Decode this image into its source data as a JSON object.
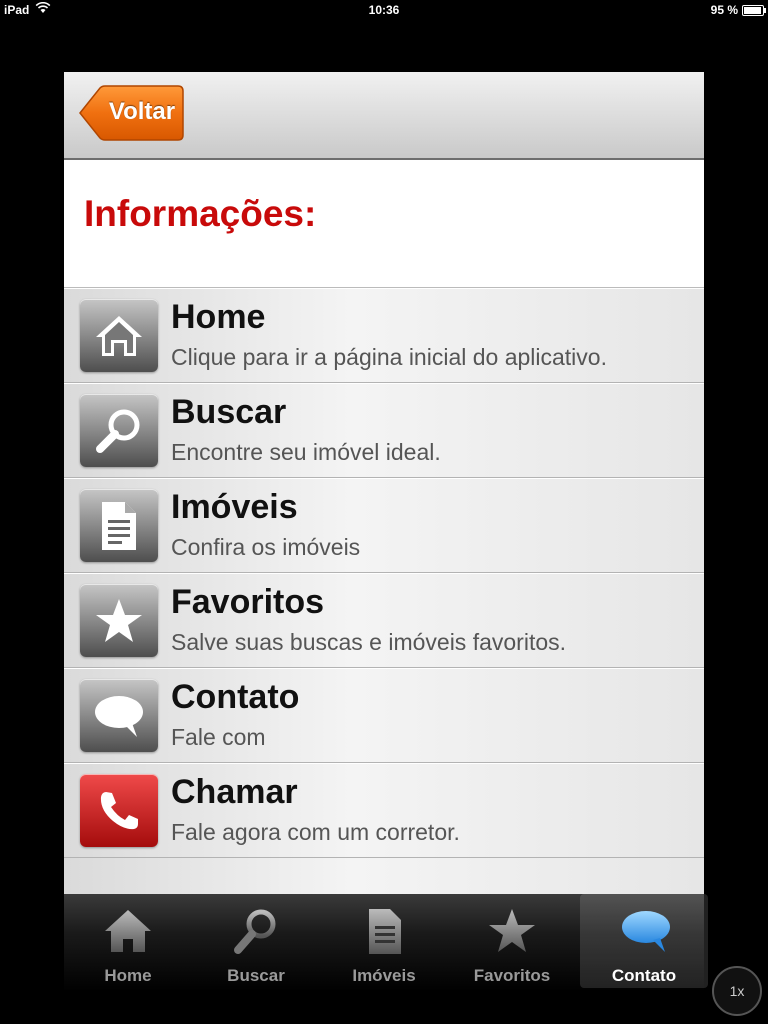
{
  "status_bar": {
    "device": "iPad",
    "time": "10:36",
    "battery": "95 %",
    "battery_level": 0.95
  },
  "navbar": {
    "back_label": "Voltar"
  },
  "page": {
    "heading": "Informações:"
  },
  "menu": [
    {
      "title": "Home",
      "subtitle": "Clique para ir a página inicial do aplicativo.",
      "icon": "home-icon"
    },
    {
      "title": "Buscar",
      "subtitle": "Encontre seu imóvel ideal.",
      "icon": "search-icon"
    },
    {
      "title": "Imóveis",
      "subtitle": "Confira os imóveis",
      "icon": "document-icon"
    },
    {
      "title": "Favoritos",
      "subtitle": "Salve suas buscas e imóveis favoritos.",
      "icon": "star-icon"
    },
    {
      "title": "Contato",
      "subtitle": "Fale com",
      "icon": "speech-bubble-icon"
    },
    {
      "title": "Chamar",
      "subtitle": "Fale agora com um corretor.",
      "icon": "phone-icon"
    }
  ],
  "tabbar": {
    "tabs": [
      {
        "label": "Home",
        "icon": "home-icon"
      },
      {
        "label": "Buscar",
        "icon": "search-icon"
      },
      {
        "label": "Imóveis",
        "icon": "document-icon"
      },
      {
        "label": "Favoritos",
        "icon": "star-icon"
      },
      {
        "label": "Contato",
        "icon": "speech-bubble-icon"
      }
    ],
    "active": "Contato"
  },
  "zoom": {
    "label": "1x"
  },
  "colors": {
    "heading": "#c80a0a",
    "back_button": "#f07010",
    "call_icon": "#d01818",
    "active_tab_icon": "#4aa8f0"
  }
}
